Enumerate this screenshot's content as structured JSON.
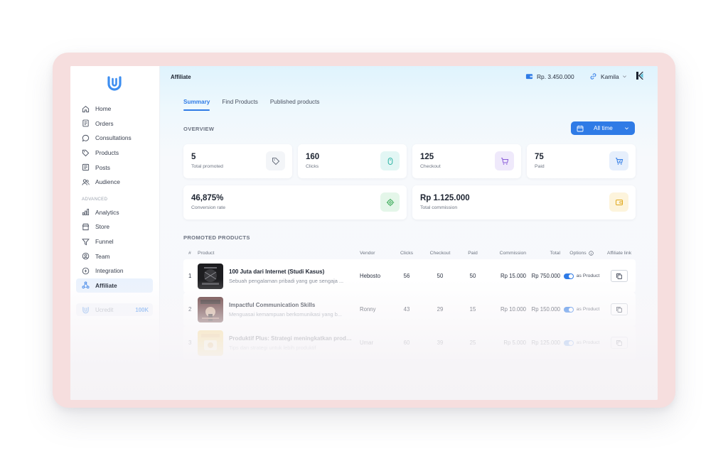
{
  "sidebar": {
    "items": [
      {
        "label": "Home",
        "icon": "home-icon"
      },
      {
        "label": "Orders",
        "icon": "orders-icon"
      },
      {
        "label": "Consultations",
        "icon": "chat-icon"
      },
      {
        "label": "Products",
        "icon": "tag-icon"
      },
      {
        "label": "Posts",
        "icon": "posts-icon"
      },
      {
        "label": "Audience",
        "icon": "users-icon"
      }
    ],
    "section_label": "ADVANCED",
    "advanced_items": [
      {
        "label": "Analytics",
        "icon": "bar-chart-icon"
      },
      {
        "label": "Store",
        "icon": "store-icon"
      },
      {
        "label": "Funnel",
        "icon": "funnel-icon"
      },
      {
        "label": "Team",
        "icon": "team-icon"
      },
      {
        "label": "Integration",
        "icon": "integration-icon"
      },
      {
        "label": "Affiliate",
        "icon": "affiliate-icon",
        "active": true
      }
    ],
    "ucredit": {
      "label": "Ucredit",
      "value": "100K"
    }
  },
  "header": {
    "title": "Affiliate",
    "balance": "Rp. 3.450.000",
    "user": "Kamila"
  },
  "tabs": [
    "Summary",
    "Find Products",
    "Published products"
  ],
  "overview": {
    "label": "OVERVIEW",
    "filter": "All time",
    "cards": [
      {
        "value": "5",
        "label": "Total promoted",
        "icon": "tag-icon",
        "color": "#f3f5f8"
      },
      {
        "value": "160",
        "label": "Clicks",
        "icon": "mouse-icon",
        "color": "#e2f6f4"
      },
      {
        "value": "125",
        "label": "Checkout",
        "icon": "cart-icon",
        "color": "#efe9fb"
      },
      {
        "value": "75",
        "label": "Paid",
        "icon": "cart-check-icon",
        "color": "#e6effc"
      },
      {
        "value": "46,875%",
        "label": "Conversion rate",
        "icon": "target-icon",
        "color": "#e4f6e9"
      },
      {
        "value": "Rp 1.125.000",
        "label": "Total commission",
        "icon": "wallet-icon",
        "color": "#fdf4dc"
      }
    ]
  },
  "promoted": {
    "label": "PROMOTED PRODUCTS",
    "columns": {
      "idx": "#",
      "product": "Product",
      "vendor": "Vendor",
      "clicks": "Clicks",
      "checkout": "Checkout",
      "paid": "Paid",
      "commission": "Commission",
      "total": "Total",
      "options": "Options",
      "link": "Affiliate link"
    },
    "rows": [
      {
        "idx": "1",
        "name": "100 Juta dari Internet (Studi Kasus)",
        "desc": "Sebuah pengalaman pribadi yang gue sengaja ...",
        "vendor": "Hebosto",
        "clicks": "56",
        "checkout": "50",
        "paid": "50",
        "commission": "Rp 15.000",
        "total": "Rp 750.000",
        "option": "as Product"
      },
      {
        "idx": "2",
        "name": "Impactful Communication Skills",
        "desc": "Menguasai kemampuan berkomunikasi yang b...",
        "vendor": "Ronny",
        "clicks": "43",
        "checkout": "29",
        "paid": "15",
        "commission": "Rp 10.000",
        "total": "Rp 150.000",
        "option": "as Product"
      },
      {
        "idx": "3",
        "name": "Produktif Plus: Strategi meningkatkan produktifitas untuk memaksimalkan potensi diri",
        "desc": "Tips dan strategi untuk lebih produktif",
        "vendor": "Umar",
        "clicks": "60",
        "checkout": "39",
        "paid": "25",
        "commission": "Rp 5.000",
        "total": "Rp 125.000",
        "option": "as Product"
      }
    ]
  },
  "colors": {
    "accent": "#2f7be6",
    "active_bg": "#eaf2fd"
  }
}
